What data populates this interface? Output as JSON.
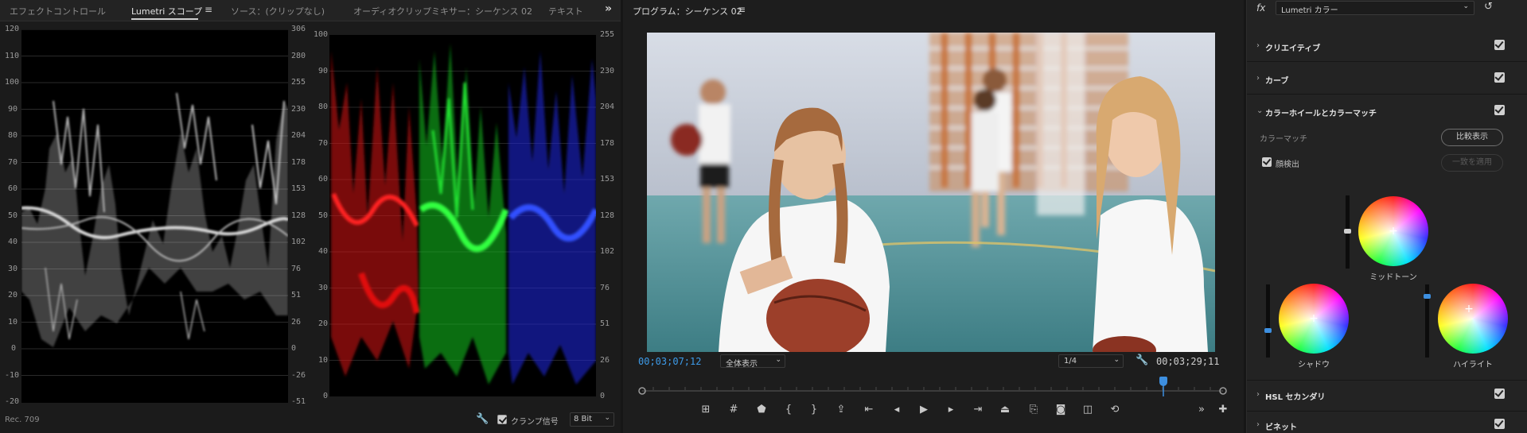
{
  "left_tabs": {
    "effect_controls": "エフェクトコントロール",
    "lumetri_scopes": "Lumetri スコープ",
    "source": "ソース：(クリップなし)",
    "audio_mixer": "オーディオクリップミキサー：シーケンス 02",
    "text": "テキスト"
  },
  "waveform": {
    "left_axis": [
      "120",
      "110",
      "100",
      "90",
      "80",
      "70",
      "60",
      "50",
      "40",
      "30",
      "20",
      "10",
      "0",
      "-10",
      "-20"
    ],
    "right_axis": [
      "306",
      "280",
      "255",
      "230",
      "204",
      "178",
      "153",
      "128",
      "102",
      "76",
      "51",
      "26",
      "0",
      "-26",
      "-51"
    ]
  },
  "parade": {
    "left_axis": [
      "100",
      "90",
      "80",
      "70",
      "60",
      "50",
      "40",
      "30",
      "20",
      "10",
      "0"
    ],
    "right_axis": [
      "255",
      "230",
      "204",
      "178",
      "153",
      "128",
      "102",
      "76",
      "51",
      "26",
      "0"
    ]
  },
  "scope_footer": {
    "colorspace": "Rec. 709",
    "clamp_label": "クランプ信号",
    "bit_depth": "8 Bit"
  },
  "program": {
    "title": "プログラム：シーケンス 02",
    "timecode_current": "00;03;07;12",
    "timecode_total": "00;03;29;11",
    "fit": "全体表示",
    "resolution": "1/4"
  },
  "lumetri": {
    "effect_name": "Lumetri カラー",
    "sections": {
      "creative": "クリエイティブ",
      "curves": "カーブ",
      "color_wheels": "カラーホイールとカラーマッチ",
      "hsl": "HSL セカンダリ",
      "vignette": "ビネット"
    },
    "color_match_label": "カラーマッチ",
    "compare_button": "比較表示",
    "face_detect_label": "顔検出",
    "apply_button": "一致を適用",
    "wheels": {
      "midtones": "ミッドトーン",
      "shadows": "シャドウ",
      "highlights": "ハイライト"
    }
  },
  "colors": {
    "accent_blue": "#3d9be9",
    "panel_bg": "#232323",
    "scope_bg": "#000000"
  }
}
